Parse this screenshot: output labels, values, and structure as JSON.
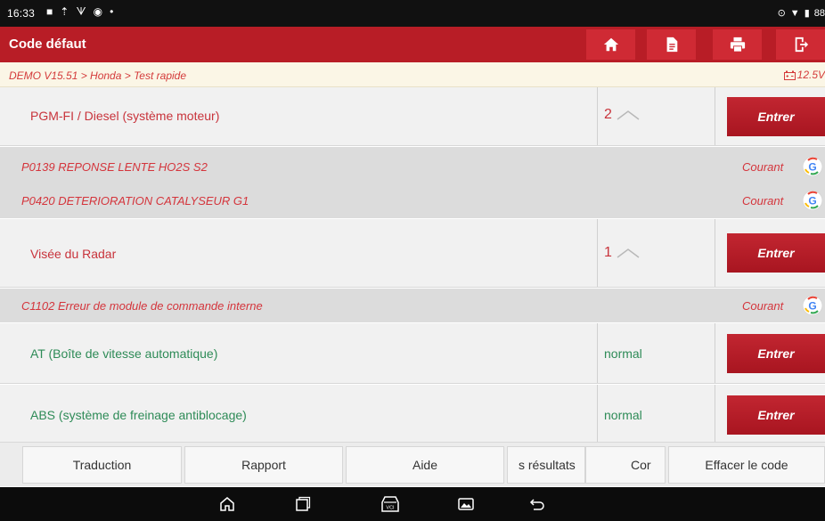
{
  "statusbar": {
    "time": "16:33",
    "battery": "88"
  },
  "header": {
    "title": "Code défaut"
  },
  "breadcrumb": {
    "path": "DEMO V15.51 > Honda > Test rapide",
    "voltage": "12.5V"
  },
  "systems": [
    {
      "name": "PGM-FI / Diesel (système moteur)",
      "count": "2",
      "status": "",
      "button": "Entrer"
    },
    {
      "name": "Visée du Radar",
      "count": "1",
      "status": "",
      "button": "Entrer"
    },
    {
      "name": "AT (Boîte de vitesse automatique)",
      "count": "",
      "status": "normal",
      "button": "Entrer"
    },
    {
      "name": "ABS (système de freinage antiblocage)",
      "count": "",
      "status": "normal",
      "button": "Entrer"
    }
  ],
  "faults": [
    {
      "code": "P0139  REPONSE LENTE HO2S S2",
      "state": "Courant"
    },
    {
      "code": "P0420  DETERIORATION CATALYSEUR G1",
      "state": "Courant"
    },
    {
      "code": "C1102 Erreur de module de commande interne",
      "state": "Courant"
    }
  ],
  "actions": {
    "translation": "Traduction",
    "report": "Rapport",
    "help": "Aide",
    "results": "s résultats",
    "compare": "Cor",
    "clear": "Effacer le code"
  },
  "colors": {
    "brand": "#b81d26",
    "fault_text": "#d4353c",
    "normal_text": "#2e8b57"
  }
}
